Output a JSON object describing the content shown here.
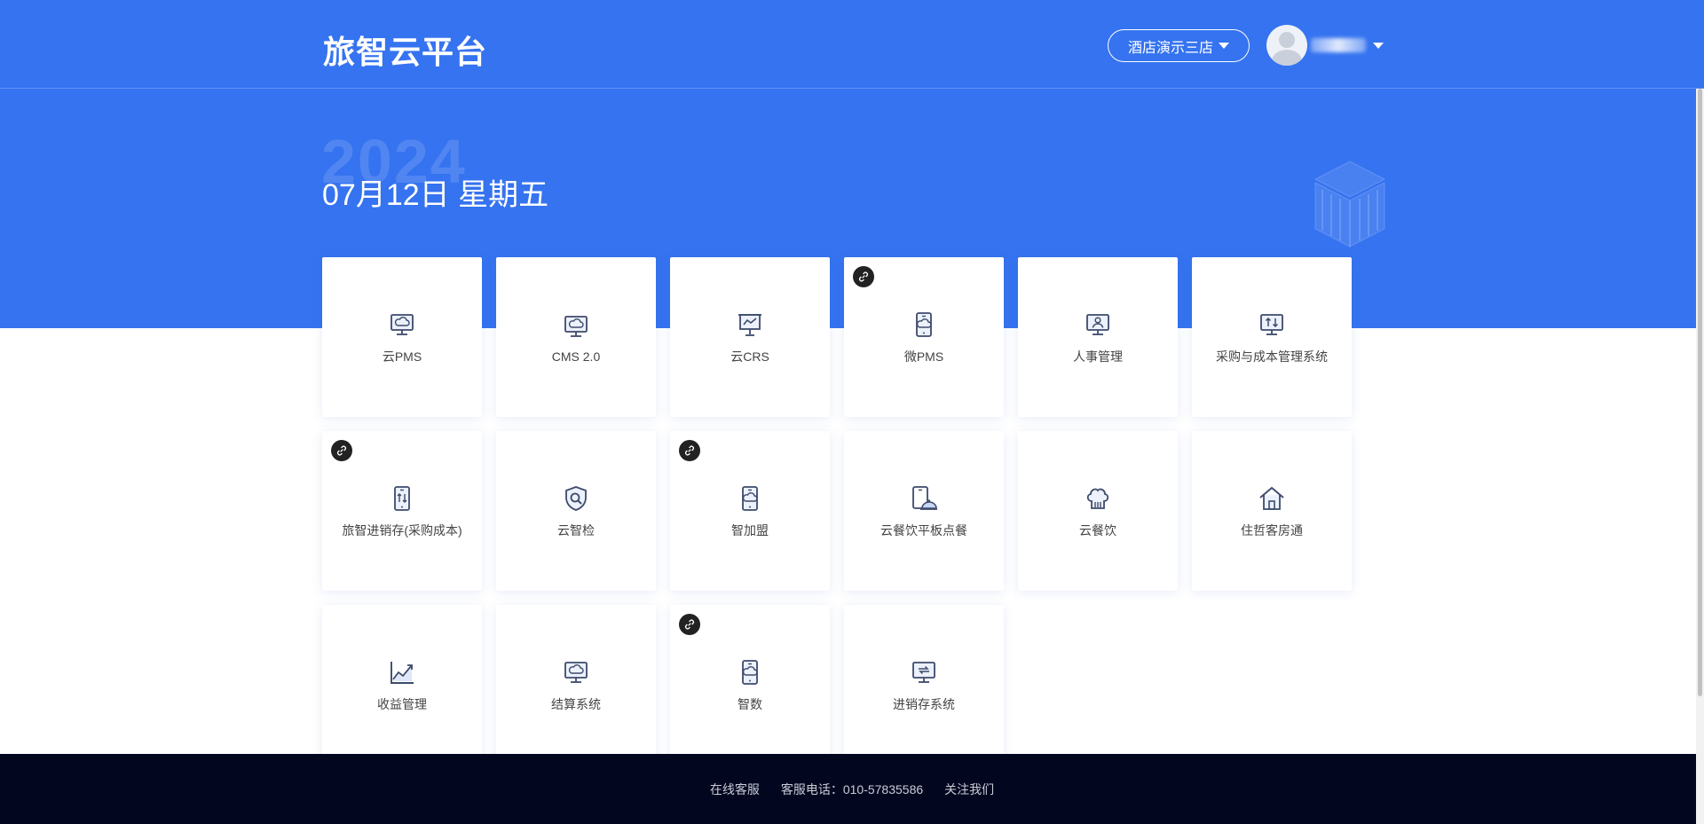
{
  "header": {
    "brand": "旅智云平台",
    "hotel_selector": "酒店演示三店"
  },
  "hero": {
    "year": "2024",
    "date": "07月12日 星期五"
  },
  "apps": [
    {
      "label": "云PMS",
      "icon": "monitor-cloud-icon",
      "mini_program": false
    },
    {
      "label": "CMS 2.0",
      "icon": "monitor-cloud-icon",
      "mini_program": false
    },
    {
      "label": "云CRS",
      "icon": "presentation-chart-icon",
      "mini_program": false
    },
    {
      "label": "微PMS",
      "icon": "tablet-cloud-icon",
      "mini_program": true
    },
    {
      "label": "人事管理",
      "icon": "monitor-person-icon",
      "mini_program": false
    },
    {
      "label": "采购与成本管理系统",
      "icon": "monitor-arrows-icon",
      "mini_program": false
    },
    {
      "label": "旅智进销存(采购成本)",
      "icon": "tablet-arrows-icon",
      "mini_program": true
    },
    {
      "label": "云智检",
      "icon": "shield-search-icon",
      "mini_program": false
    },
    {
      "label": "智加盟",
      "icon": "tablet-cloud-icon",
      "mini_program": true
    },
    {
      "label": "云餐饮平板点餐",
      "icon": "tablet-dish-icon",
      "mini_program": false
    },
    {
      "label": "云餐饮",
      "icon": "chef-hat-icon",
      "mini_program": false
    },
    {
      "label": "住哲客房通",
      "icon": "house-icon",
      "mini_program": false
    },
    {
      "label": "收益管理",
      "icon": "growth-chart-icon",
      "mini_program": false
    },
    {
      "label": "结算系统",
      "icon": "monitor-cloud-icon",
      "mini_program": false
    },
    {
      "label": "智数",
      "icon": "tablet-cloud-icon",
      "mini_program": true
    },
    {
      "label": "进销存系统",
      "icon": "monitor-cycle-icon",
      "mini_program": false
    }
  ],
  "footer": {
    "online_service": "在线客服",
    "hotline": "客服电话：010-57835586",
    "follow_us": "关注我们"
  },
  "colors": {
    "primary": "#3573f0",
    "footer_bg": "#03061f",
    "icon_stroke": "#3d4a6b",
    "icon_fill": "#c9d7f7"
  }
}
